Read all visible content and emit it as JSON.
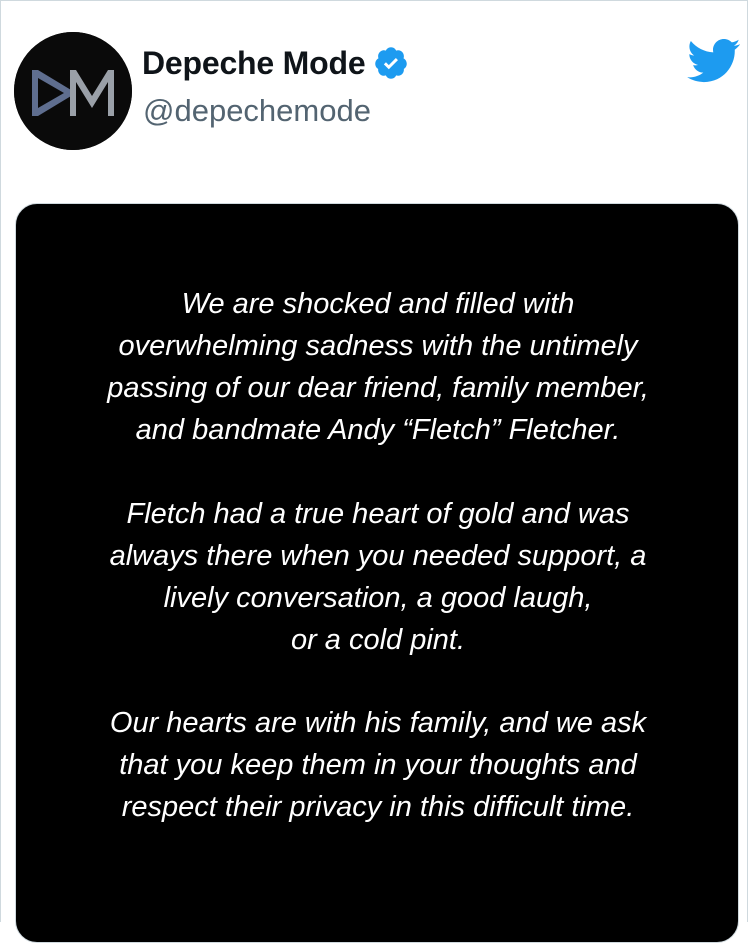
{
  "author": {
    "display_name": "Depeche Mode",
    "handle": "@depechemode",
    "verified": true,
    "avatar_icon": "depeche-mode-dm-logo",
    "avatar_logo_text": "DM"
  },
  "brand": {
    "icon": "twitter-bird-icon",
    "twitter_blue": "#1d9bf0",
    "verified_blue": "#1d9bf0"
  },
  "media": {
    "background": "#000000",
    "paragraphs": [
      "We are shocked and filled with\noverwhelming sadness with the untimely\npassing of our dear friend, family member,\nand bandmate Andy “Fletch” Fletcher.",
      "Fletch had a true heart of gold and was\nalways there when you needed support, a\nlively conversation, a good laugh,\nor a cold pint.",
      "Our hearts are with his family, and we ask\nthat you keep them in your thoughts and\nrespect their privacy in this difficult time."
    ]
  }
}
